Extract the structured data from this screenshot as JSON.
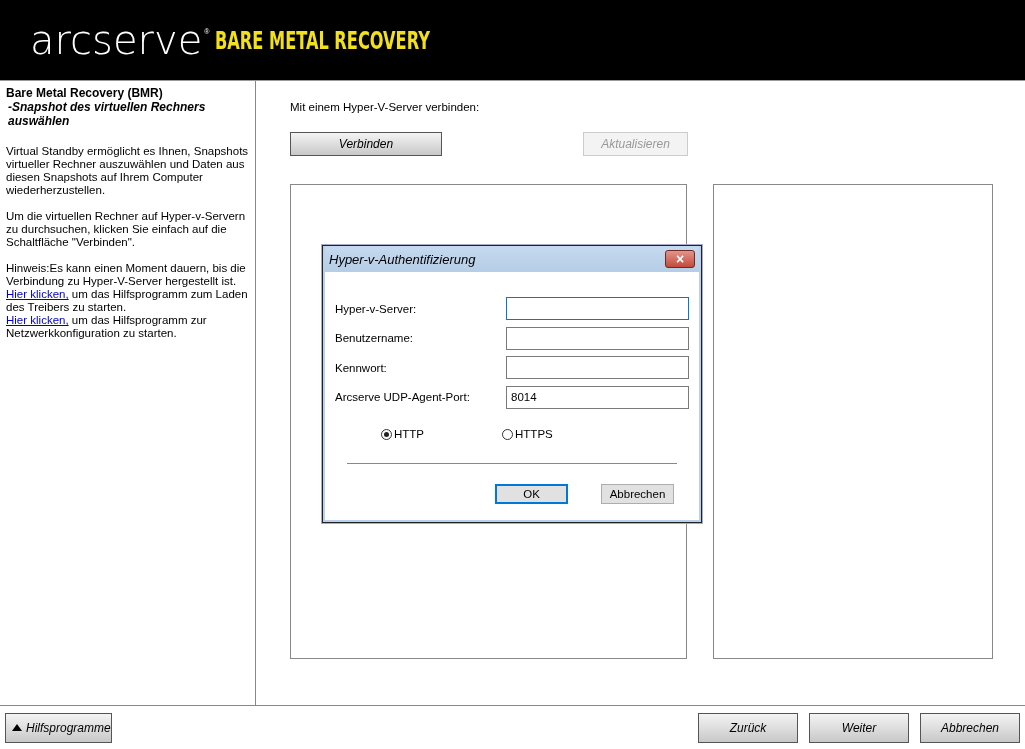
{
  "header": {
    "brand": "arcserve",
    "registered": "®",
    "product": "BARE METAL RECOVERY"
  },
  "sidebar": {
    "title": "Bare Metal Recovery (BMR)",
    "subtitle": "-Snapshot des virtuellen Rechners auswählen",
    "paragraphs": [
      {
        "kind": "text",
        "text": "Virtual Standby ermöglicht es Ihnen, Snapshots virtueller Rechner auszuwählen und Daten aus diesen Snapshots auf Ihrem Computer wiederherzustellen."
      },
      {
        "kind": "text",
        "text": "Um die virtuellen Rechner auf Hyper-v-Servern zu durchsuchen, klicken Sie einfach auf die Schaltfläche \"Verbinden\"."
      },
      {
        "kind": "text",
        "text": "Hinweis:Es kann einen Moment dauern, bis die Verbindung zu Hyper-V-Server hergestellt ist."
      },
      {
        "kind": "link",
        "link": "Hier klicken,",
        "text": " um das Hilfsprogramm zum Laden des Treibers zu starten."
      },
      {
        "kind": "link",
        "link": "Hier klicken,",
        "text": " um das Hilfsprogramm zur Netzwerkkonfiguration zu starten."
      }
    ]
  },
  "main": {
    "prompt": "Mit einem Hyper-V-Server verbinden:",
    "buttons": [
      {
        "label": "Verbinden",
        "disabled": false
      },
      {
        "label": "Aktualisieren",
        "disabled": true
      }
    ]
  },
  "dialog": {
    "title": "Hyper-v-Authentifizierung",
    "close": "×",
    "fields": [
      {
        "label": "Hyper-v-Server:",
        "focused": true
      },
      {
        "label": "Benutzername:",
        "focused": false
      },
      {
        "label": "Kennwort:",
        "focused": false
      },
      {
        "label": "Arcserve UDP-Agent-Port:",
        "value": "8014",
        "focused": false
      }
    ],
    "protocols": [
      {
        "label": "HTTP",
        "selected": true
      },
      {
        "label": "HTTPS",
        "selected": false
      }
    ],
    "buttons": [
      {
        "label": "OK",
        "default": true
      },
      {
        "label": "Abbrechen",
        "default": false
      }
    ]
  },
  "footer": {
    "tools": {
      "label": "Hilfsprogramme"
    },
    "buttons": [
      {
        "label": "Zurück"
      },
      {
        "label": "Weiter"
      },
      {
        "label": "Abbrechen"
      }
    ]
  }
}
